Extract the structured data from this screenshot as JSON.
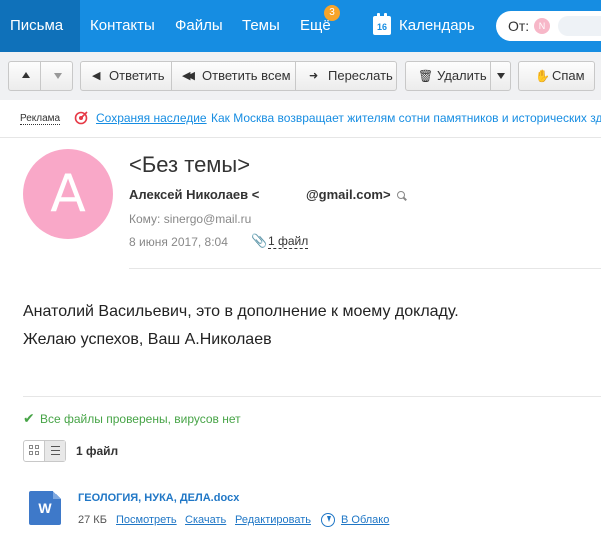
{
  "nav": {
    "items": [
      {
        "label": "Письма",
        "active": true
      },
      {
        "label": "Контакты",
        "active": false
      },
      {
        "label": "Файлы",
        "active": false
      },
      {
        "label": "Темы",
        "active": false
      },
      {
        "label": "Ещё",
        "active": false
      }
    ],
    "more_badge": "3",
    "calendar_label": "Календарь",
    "calendar_day": "16",
    "from_label": "От:",
    "from_avatar": "N",
    "accent_color": "#168de2"
  },
  "toolbar": {
    "reply": "Ответить",
    "reply_all": "Ответить всем",
    "forward": "Переслать",
    "delete": "Удалить",
    "spam": "Спам"
  },
  "ad": {
    "label": "Реклама",
    "title": "Сохраняя наследие",
    "text": "Как Москва возвращает жителям сотни памятников и исторических зд"
  },
  "message": {
    "subject": "<Без темы>",
    "avatar_letter": "A",
    "avatar_color": "#f9a8c8",
    "sender_name": "Алексей Николаев <",
    "sender_email_suffix": "@gmail.com>",
    "to": "Кому: sinergo@mail.ru",
    "date": "8 июня 2017, 8:04",
    "attachments_link": "1 файл",
    "body": [
      "Анатолий Васильевич, это в дополнение к моему докладу.",
      "Желаю успехов, Ваш А.Николаев"
    ]
  },
  "attachments": {
    "virus_status": "Все файлы проверены, вирусов нет",
    "count_label": "1 файл",
    "items": [
      {
        "icon_letter": "W",
        "name": "ГЕОЛОГИЯ, НУКА, ДЕЛА.docx",
        "size": "27 КБ",
        "view": "Посмотреть",
        "download": "Скачать",
        "edit": "Редактировать",
        "to_cloud": "В Облако"
      }
    ]
  }
}
